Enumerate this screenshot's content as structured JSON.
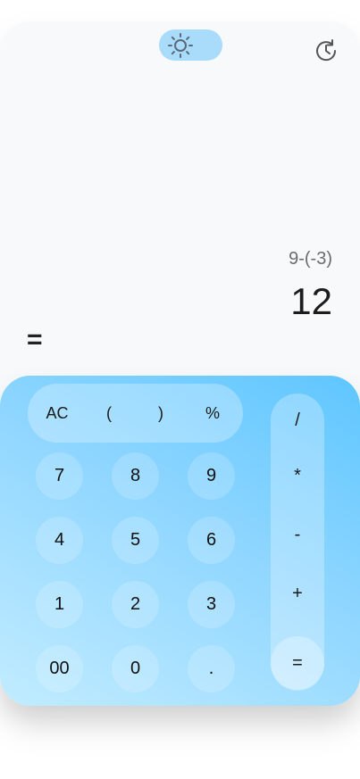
{
  "header": {
    "theme_toggle_icon": "sun-icon",
    "history_icon": "history-icon"
  },
  "display": {
    "expression": "9-(-3)",
    "result": "12",
    "equals_label": "="
  },
  "keypad": {
    "function_keys": [
      "AC",
      "(",
      ")",
      "%"
    ],
    "number_rows": [
      [
        "7",
        "8",
        "9"
      ],
      [
        "4",
        "5",
        "6"
      ],
      [
        "1",
        "2",
        "3"
      ],
      [
        "00",
        "0",
        "."
      ]
    ],
    "operator_keys": [
      "/",
      "*",
      "-",
      "+",
      "="
    ]
  },
  "colors": {
    "keypad_gradient_start": "#c2ecff",
    "keypad_gradient_end": "#5ec6ff",
    "toggle_bg": "#a9dcfb",
    "card_bg": "#f8f9fb"
  }
}
